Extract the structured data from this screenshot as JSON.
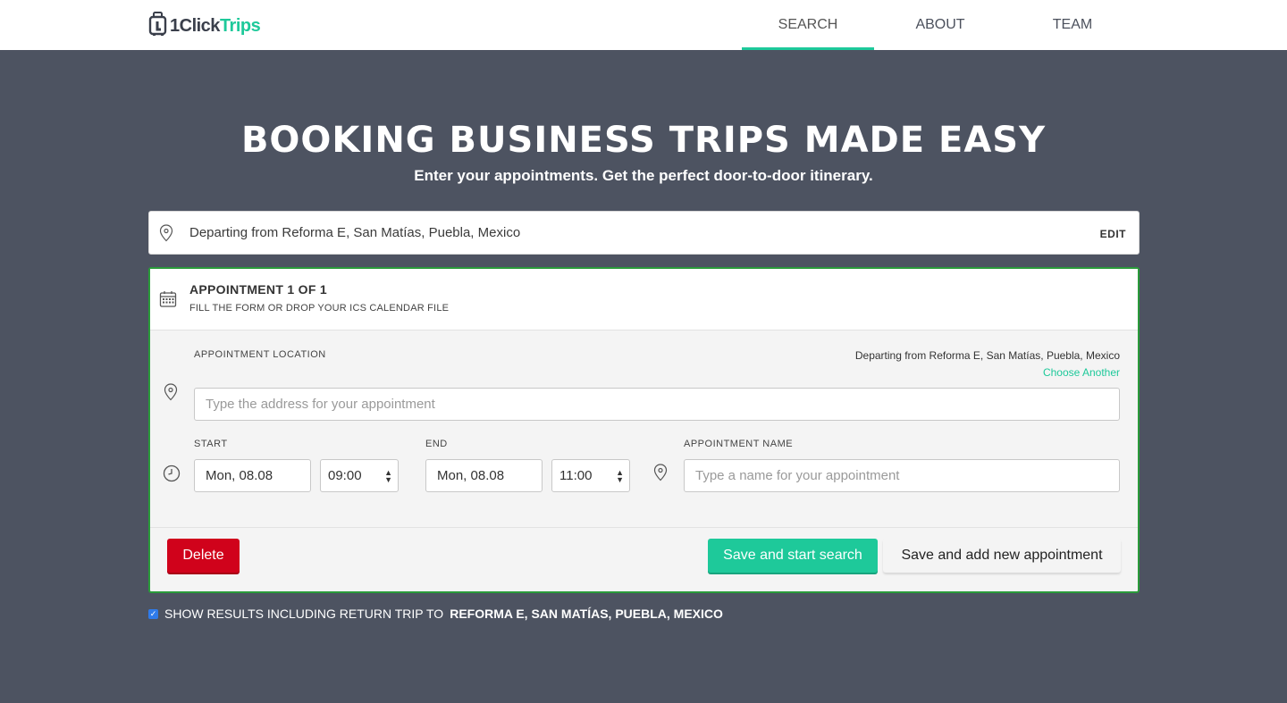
{
  "brand": {
    "logo_prefix": "1Click",
    "logo_suffix": "Trips",
    "accent": "#1ec99a"
  },
  "nav": {
    "items": [
      {
        "label": "SEARCH",
        "active": true
      },
      {
        "label": "ABOUT",
        "active": false
      },
      {
        "label": "TEAM",
        "active": false
      }
    ]
  },
  "hero": {
    "title": "BOOKING BUSINESS TRIPS MADE EASY",
    "subtitle": "Enter your appointments. Get the perfect door-to-door itinerary."
  },
  "departure": {
    "text": "Departing from Reforma E, San Matías, Puebla, Mexico",
    "edit_label": "EDIT"
  },
  "appointment": {
    "title": "APPOINTMENT 1 OF 1",
    "subtitle": "FILL THE FORM OR DROP YOUR ICS CALENDAR FILE",
    "location_label": "APPOINTMENT LOCATION",
    "departing_info": "Departing from Reforma E, San Matías, Puebla, Mexico",
    "choose_another": "Choose Another",
    "address_placeholder": "Type the address for your appointment",
    "start_label": "START",
    "start_date": "Mon, 08.08",
    "start_time": "09:00",
    "end_label": "END",
    "end_date": "Mon, 08.08",
    "end_time": "11:00",
    "name_label": "APPOINTMENT NAME",
    "name_placeholder": "Type a name for your appointment"
  },
  "buttons": {
    "delete": "Delete",
    "save_search": "Save and start search",
    "save_add": "Save and add new appointment"
  },
  "return_trip": {
    "checked": true,
    "label": "SHOW RESULTS INCLUDING RETURN TRIP TO",
    "destination": "REFORMA E, SAN MATÍAS, PUEBLA, MEXICO"
  },
  "colors": {
    "background": "#4d5361",
    "delete": "#d0021b",
    "card_border": "#2a9b3a",
    "checkbox": "#2f7bea"
  }
}
